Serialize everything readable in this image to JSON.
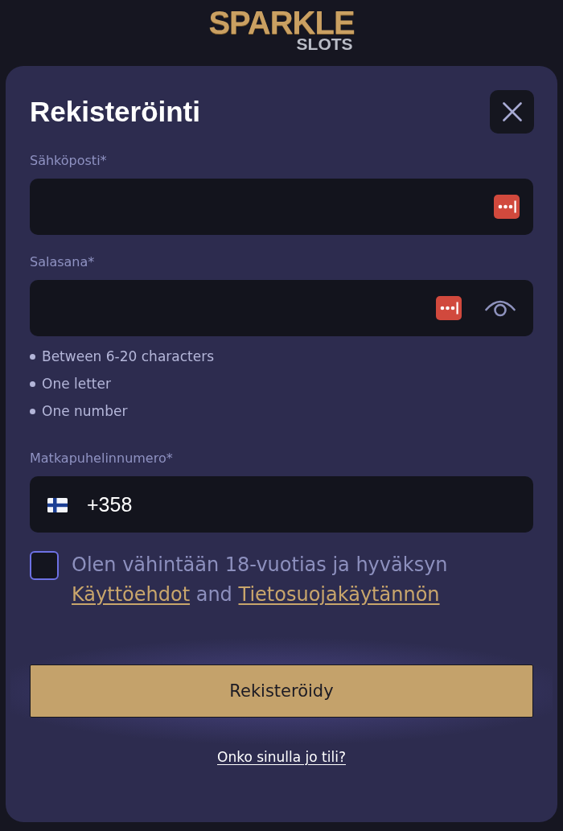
{
  "logo": {
    "title": "SPARKLE",
    "subtitle": "SLOTS"
  },
  "dialog": {
    "title": "Rekisteröinti"
  },
  "fields": [
    {
      "kind": "email",
      "label": "Sähköposti*"
    },
    {
      "kind": "password",
      "label": "Salasana*",
      "rules": [
        "Between 6-20 characters",
        "One letter",
        "One number"
      ]
    },
    {
      "kind": "phone",
      "label": "Matkapuhelinnumero*",
      "value": "+358"
    }
  ],
  "consent": {
    "checked": false,
    "parts": [
      {
        "kind": "text",
        "text": "Olen vähintään 18-vuotias ja hyväksyn"
      },
      {
        "kind": "link",
        "text": "Käyttöehdot"
      },
      {
        "kind": "text",
        "text": "and"
      },
      {
        "kind": "link",
        "text": "Tietosuojakäytännön"
      }
    ]
  },
  "submit_button": "Rekisteröidy",
  "login_link": "Onko sinulla jo tili?"
}
